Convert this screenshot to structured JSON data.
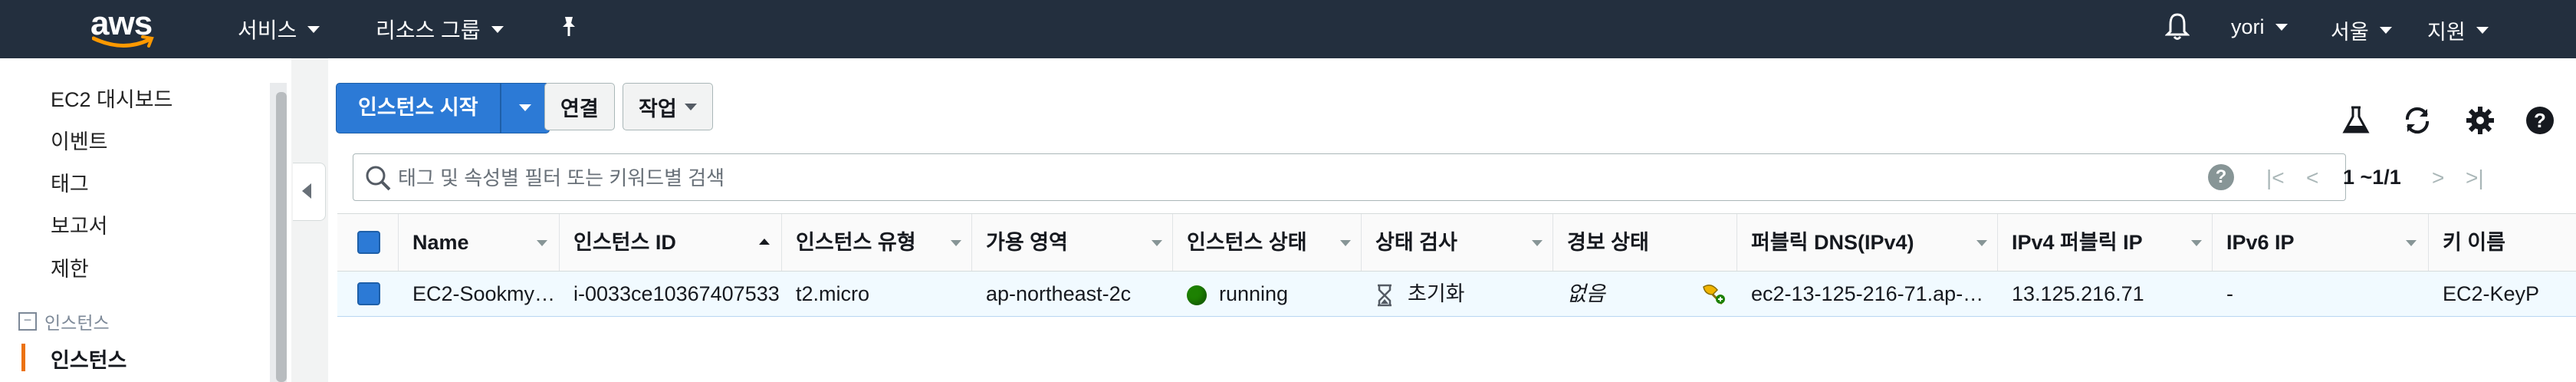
{
  "header": {
    "logo_text": "aws",
    "services_label": "서비스",
    "resource_groups_label": "리소스 그룹",
    "user_label": "yori",
    "region_label": "서울",
    "support_label": "지원"
  },
  "sidebar": {
    "items": [
      {
        "label": "EC2 대시보드"
      },
      {
        "label": "이벤트"
      },
      {
        "label": "태그"
      },
      {
        "label": "보고서"
      },
      {
        "label": "제한"
      }
    ],
    "section_label": "인스턴스",
    "active_item": "인스턴스"
  },
  "toolbar": {
    "launch_label": "인스턴스 시작",
    "connect_label": "연결",
    "actions_label": "작업"
  },
  "search": {
    "placeholder": "태그 및 속성별 필터 또는 키워드별 검색"
  },
  "pagination": {
    "label": "1 ~1/1"
  },
  "table": {
    "columns": [
      "Name",
      "인스턴스 ID",
      "인스턴스 유형",
      "가용 영역",
      "인스턴스 상태",
      "상태 검사",
      "경보 상태",
      "퍼블릭 DNS(IPv4)",
      "IPv4 퍼블릭 IP",
      "IPv6 IP",
      "키 이름"
    ],
    "rows": [
      {
        "name": "EC2-Sookmy…",
        "instance_id": "i-0033ce10367407533",
        "instance_type": "t2.micro",
        "availability_zone": "ap-northeast-2c",
        "instance_state": "running",
        "status_check": "초기화",
        "alarm_status": "없음",
        "public_dns": "ec2-13-125-216-71.ap-…",
        "public_ip": "13.125.216.71",
        "ipv6": "-",
        "key_name": "EC2-KeyP"
      }
    ]
  },
  "colors": {
    "topbar": "#232f3e",
    "primary": "#2c7ad6",
    "running": "#1d8102",
    "active_accent": "#ec7211"
  }
}
